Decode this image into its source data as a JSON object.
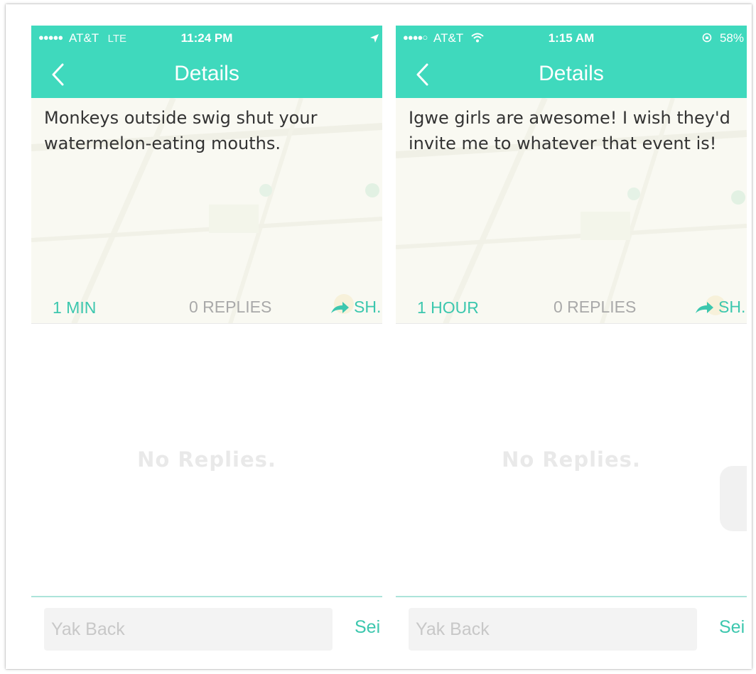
{
  "theme": {
    "accent": "#3fd9bd",
    "accent_text": "#3cc7ae",
    "muted": "#a9a9a9"
  },
  "panels": [
    {
      "status": {
        "signal": "●●●●●",
        "carrier": "AT&T",
        "network": "LTE",
        "time": "11:24 PM",
        "battery": ""
      },
      "nav": {
        "back_icon": "chevron-left-icon",
        "title": "Details"
      },
      "post": {
        "text": "Monkeys outside swig shut your watermelon-eating mouths.",
        "age": "1 MIN",
        "replies": "0 REPLIES",
        "share": "SH."
      },
      "empty_state": "No Replies.",
      "composer": {
        "placeholder": "Yak Back",
        "send": "Sei"
      }
    },
    {
      "status": {
        "signal": "●●●●○",
        "carrier": "AT&T",
        "network": "",
        "time": "1:15 AM",
        "battery": "58%"
      },
      "nav": {
        "back_icon": "chevron-left-icon",
        "title": "Details"
      },
      "post": {
        "text": "Igwe girls are awesome! I wish they'd invite me to whatever that event is!",
        "age": "1 HOUR",
        "replies": "0 REPLIES",
        "share": "SH."
      },
      "empty_state": "No Replies.",
      "composer": {
        "placeholder": "Yak Back",
        "send": "Sei"
      }
    }
  ]
}
